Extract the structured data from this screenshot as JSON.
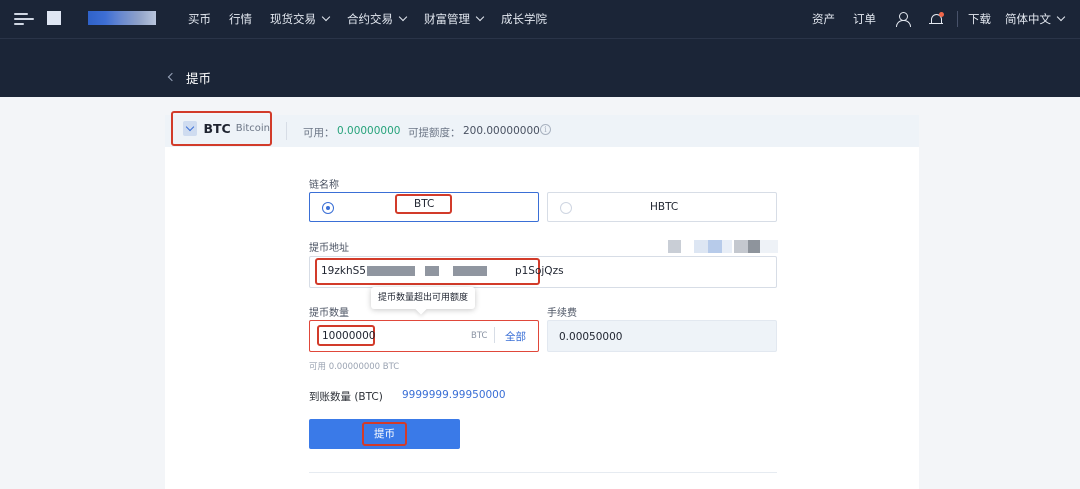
{
  "nav": {
    "links": [
      "买币",
      "行情",
      "现货交易",
      "合约交易",
      "财富管理",
      "成长学院"
    ],
    "right": {
      "assets": "资产",
      "orders": "订单",
      "download": "下载",
      "language": "简体中文"
    }
  },
  "header": {
    "title": "提币"
  },
  "coin": {
    "symbol": "BTC",
    "name": "Bitcoin",
    "available_label": "可用：",
    "available_value": "0.00000000",
    "limit_label": "可提额度：",
    "limit_value": "200.00000000"
  },
  "form": {
    "chain_label": "链名称",
    "chains": [
      {
        "label": "BTC",
        "selected": true
      },
      {
        "label": "HBTC",
        "selected": false
      }
    ],
    "address_label": "提币地址",
    "address_prefix": "19zkhS5",
    "address_suffix": "p1SojQzs",
    "tooltip": "提币数量超出可用额度",
    "amount_label": "提币数量",
    "amount_value": "10000000",
    "amount_unit": "BTC",
    "all_label": "全部",
    "fee_label": "手续费",
    "fee_value": "0.00050000",
    "available_hint": "可用 0.00000000 BTC",
    "arrival_label": "到账数量 (BTC)",
    "arrival_value": "9999999.99950000",
    "submit_label": "提币"
  },
  "colors": {
    "nav_bg": "#1b2537",
    "accent": "#3a7ae8",
    "highlight": "#d23b2a",
    "available_green": "#27a37b"
  }
}
